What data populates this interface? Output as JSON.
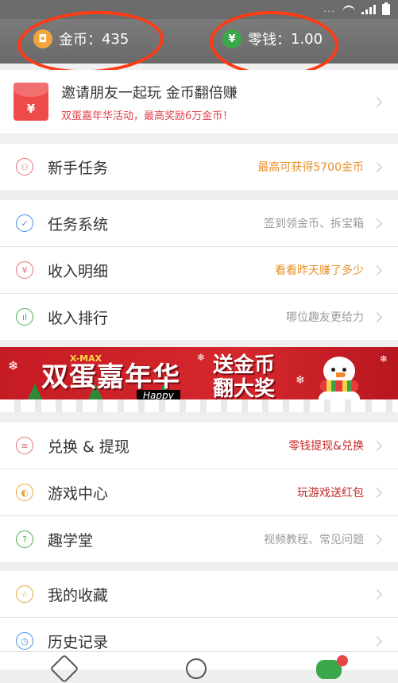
{
  "status_bar": {
    "dots": "...",
    "battery_icon": "battery-icon",
    "wifi_icon": "wifi-icon",
    "signal_icon": "signal-icon"
  },
  "wallet": {
    "coins_label": "金币：",
    "coins_value": "435",
    "change_label": "零钱：",
    "change_value": "1.00",
    "coin_icon": "coin-icon",
    "yuan_icon": "yuan-icon"
  },
  "invite": {
    "title": "邀请朋友一起玩 金币翻倍赚",
    "subtitle": "双蛋嘉年华活动，最高奖励6万金币！",
    "envelope_glyph": "¥"
  },
  "sections": {
    "newbie": [
      {
        "title": "新手任务",
        "hint": "最高可获得5700金币",
        "hint_color": "#e8902a",
        "icon": "user-icon",
        "icon_color": "#e57373",
        "glyph": "⚇"
      }
    ],
    "tasks": [
      {
        "title": "任务系统",
        "hint": "签到领金币、拆宝箱",
        "hint_color": "#9a9a9a",
        "icon": "shield-icon",
        "icon_color": "#4a90e2",
        "glyph": "✓"
      },
      {
        "title": "收入明细",
        "hint": "看看昨天赚了多少",
        "hint_color": "#e8902a",
        "icon": "yuan-circle-icon",
        "icon_color": "#e57373",
        "glyph": "¥"
      },
      {
        "title": "收入排行",
        "hint": "哪位趣友更给力",
        "hint_color": "#9a9a9a",
        "icon": "bar-chart-icon",
        "icon_color": "#4caf50",
        "glyph": "ıl"
      }
    ],
    "exchange": [
      {
        "title": "兑换 & 提现",
        "hint": "零钱提现&兑换",
        "hint_color": "#c62828",
        "icon": "database-icon",
        "icon_color": "#e57373",
        "glyph": "≡"
      },
      {
        "title": "游戏中心",
        "hint": "玩游戏送红包",
        "hint_color": "#c62828",
        "icon": "gamepad-icon",
        "icon_color": "#e8a33a",
        "glyph": "◐"
      },
      {
        "title": "趣学堂",
        "hint": "视频教程、常见问题",
        "hint_color": "#9a9a9a",
        "icon": "question-icon",
        "icon_color": "#4caf50",
        "glyph": "?"
      }
    ],
    "personal": [
      {
        "title": "我的收藏",
        "hint": "",
        "hint_color": "#9a9a9a",
        "icon": "star-icon",
        "icon_color": "#e8a33a",
        "glyph": "☆"
      },
      {
        "title": "历史记录",
        "hint": "",
        "hint_color": "#9a9a9a",
        "icon": "clock-icon",
        "icon_color": "#4a90e2",
        "glyph": "◷"
      }
    ]
  },
  "banner": {
    "xmas": "X-MAX",
    "title": "双蛋嘉年华",
    "happy_new_year": "Happy New Year",
    "slogan_line1": "送金币",
    "slogan_line2": "翻大奖"
  },
  "colors": {
    "accent_orange": "#e8902a",
    "accent_red": "#c62828",
    "annotation": "#ff3b14"
  }
}
